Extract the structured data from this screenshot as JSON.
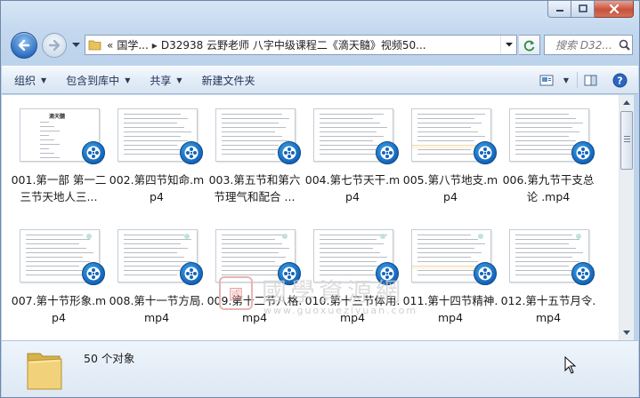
{
  "window": {
    "caption_buttons": [
      "minimize-icon",
      "maximize-icon",
      "close-icon"
    ]
  },
  "nav": {
    "address_prefix": "«",
    "address_segment1": "国学...",
    "address_segment2": "D32938  云野老师 八字中级课程二《滴天髓》视频50...",
    "search_placeholder": "搜索 D32..."
  },
  "toolbar": {
    "organize": "组织",
    "include_library": "包含到库中",
    "share": "共享",
    "new_folder": "新建文件夹"
  },
  "files": [
    {
      "name": "001.第一部 第一二三节天地人三..."
    },
    {
      "name": "002.第四节知命.mp4"
    },
    {
      "name": "003.第五节和第六节理气和配合 ..."
    },
    {
      "name": "004.第七节天干.mp4"
    },
    {
      "name": "005.第八节地支.mp4"
    },
    {
      "name": "006.第九节干支总论 .mp4"
    },
    {
      "name": "007.第十节形象.mp4"
    },
    {
      "name": "008.第十一节方局.mp4"
    },
    {
      "name": "009.第十二节八格.mp4"
    },
    {
      "name": "010.第十三节体用.mp4"
    },
    {
      "name": "011.第十四节精神.mp4"
    },
    {
      "name": "012.第十五节月令.mp4"
    }
  ],
  "thumb_title": "滴天髓",
  "watermark": {
    "seal": "國",
    "text": "國學資源網",
    "url": "www.guoxueziyuan.com"
  },
  "status": {
    "count": "50 个对象"
  },
  "colors": {
    "accent": "#2f6fc1",
    "toolbar_text": "#1e3256"
  }
}
